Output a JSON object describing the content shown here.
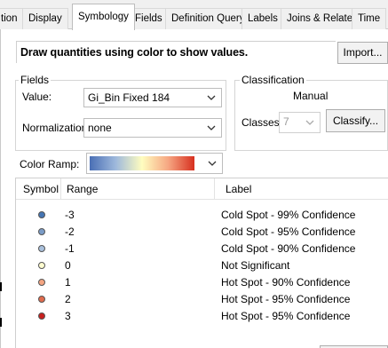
{
  "tabs": [
    {
      "label": "tion",
      "active": false
    },
    {
      "label": "Display",
      "active": false
    },
    {
      "label": "Symbology",
      "active": true
    },
    {
      "label": "Fields",
      "active": false
    },
    {
      "label": "Definition Query",
      "active": false
    },
    {
      "label": "Labels",
      "active": false
    },
    {
      "label": "Joins & Relates",
      "active": false
    },
    {
      "label": "Time",
      "active": false
    }
  ],
  "symbology": {
    "headline": "Draw quantities using color to show values.",
    "import_label": "Import...",
    "fields": {
      "group_label": "Fields",
      "value_label": "Value:",
      "value_selected": "Gi_Bin Fixed 184",
      "normalization_label": "Normalization:",
      "normalization_selected": "none"
    },
    "classification": {
      "group_label": "Classification",
      "method": "Manual",
      "classes_label": "Classes",
      "classes_value": "7",
      "classify_label": "Classify..."
    },
    "color_ramp": {
      "label": "Color Ramp:",
      "stops": [
        "#4a6fb5",
        "#9fb9dc",
        "#fffdbf",
        "#f6a682",
        "#d7301f"
      ]
    },
    "table": {
      "headers": {
        "symbol": "Symbol",
        "range": "Range",
        "label": "Label"
      },
      "rows": [
        {
          "range": "-3",
          "label": "Cold Spot - 99% Confidence",
          "color": "#4575b4"
        },
        {
          "range": "-2",
          "label": "Cold Spot - 95% Confidence",
          "color": "#7b9cc7"
        },
        {
          "range": "-1",
          "label": "Cold Spot - 90% Confidence",
          "color": "#a9c0dc"
        },
        {
          "range": "0",
          "label": "Not Significant",
          "color": "#fffdd0"
        },
        {
          "range": "1",
          "label": "Hot Spot - 90% Confidence",
          "color": "#f4a582"
        },
        {
          "range": "2",
          "label": "Hot Spot - 95% Confidence",
          "color": "#e06b4d"
        },
        {
          "range": "3",
          "label": "Hot Spot - 95% Confidence",
          "color": "#c8201e"
        }
      ]
    }
  }
}
